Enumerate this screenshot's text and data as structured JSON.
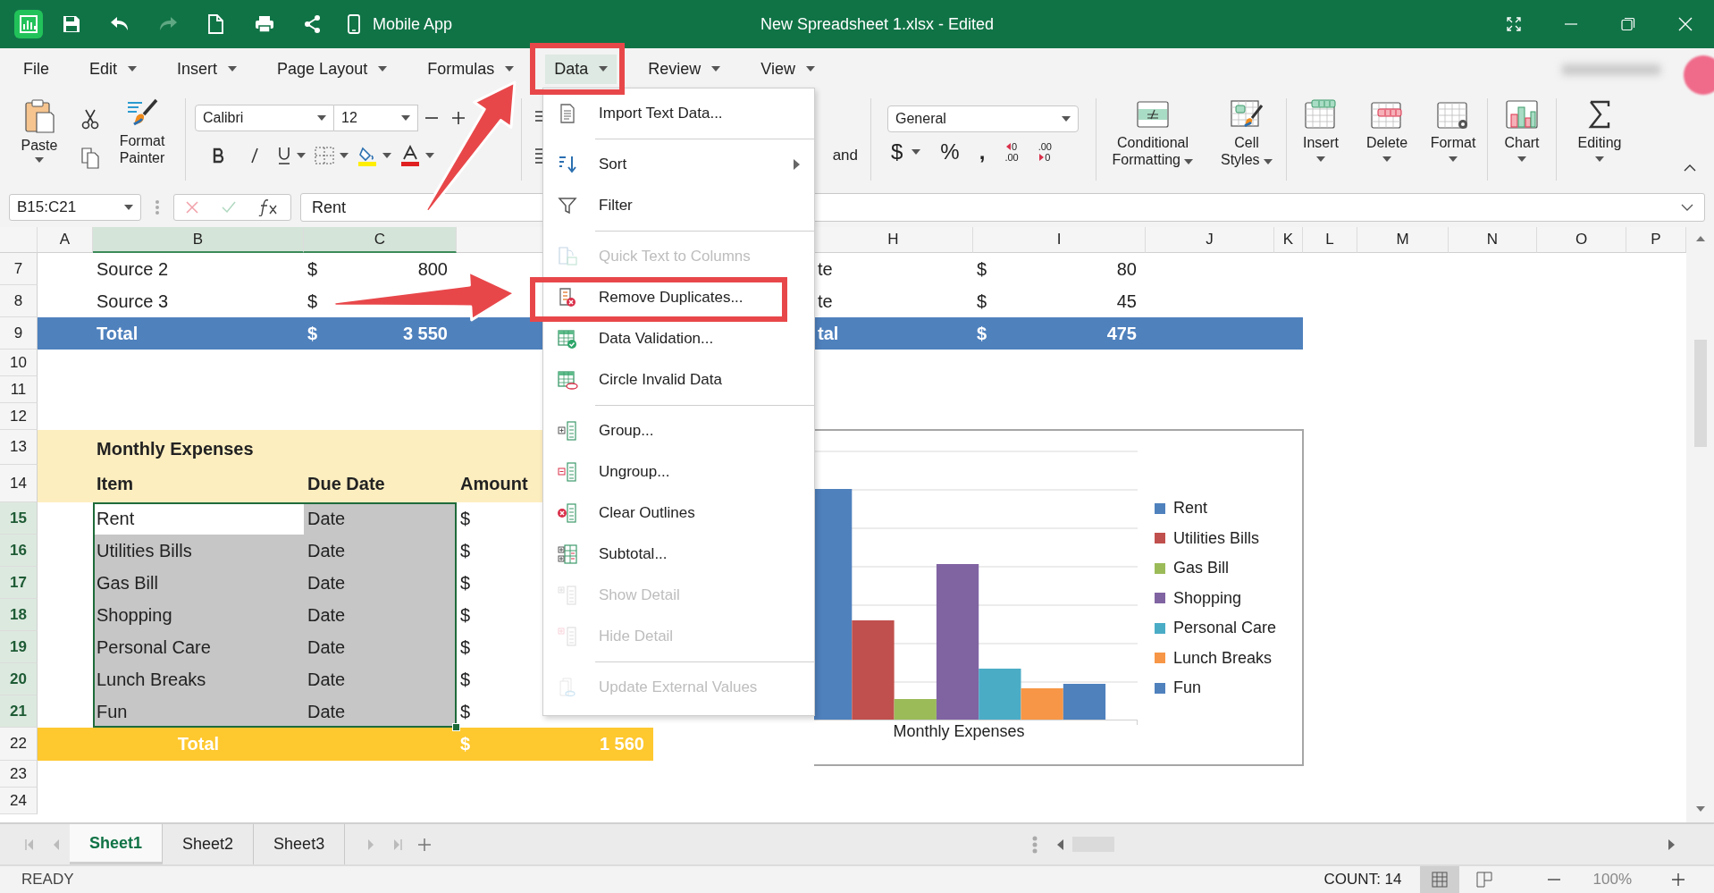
{
  "title_bar": {
    "quick_access": [
      {
        "kind": "save",
        "disabled": false
      },
      {
        "kind": "undo",
        "disabled": false
      },
      {
        "kind": "redo",
        "disabled": true
      },
      {
        "kind": "new",
        "disabled": false
      },
      {
        "kind": "print",
        "disabled": false
      },
      {
        "kind": "share",
        "disabled": false
      }
    ],
    "mobile_app": "Mobile App",
    "title": "New Spreadsheet 1.xlsx - Edited"
  },
  "menu_bar": [
    {
      "label": "File",
      "has_menu": false,
      "selected": false
    },
    {
      "label": "Edit",
      "has_menu": true,
      "selected": false
    },
    {
      "label": "Insert",
      "has_menu": true,
      "selected": false
    },
    {
      "label": "Page Layout",
      "has_menu": true,
      "selected": false
    },
    {
      "label": "Formulas",
      "has_menu": true,
      "selected": false
    },
    {
      "label": "Data",
      "has_menu": true,
      "selected": true
    },
    {
      "label": "Review",
      "has_menu": true,
      "selected": false
    },
    {
      "label": "View",
      "has_menu": true,
      "selected": false
    }
  ],
  "ribbon": {
    "paste": "Paste",
    "format_painter": "Format Painter",
    "font_name": "Calibri",
    "font_size": "12",
    "alignment_fragment": "and",
    "number_format": "General",
    "number_symbols": [
      {
        "kind": "currency",
        "label": "$"
      },
      {
        "kind": "percent",
        "label": "%"
      },
      {
        "kind": "comma",
        "label": ","
      }
    ],
    "decimals": [
      {
        "kind": "increase",
        "upper": "0",
        "lower": ".00"
      },
      {
        "kind": "decrease",
        "upper": ".00",
        "lower": "0"
      }
    ],
    "groups": [
      [
        {
          "kind": "conditional_formatting",
          "label": "Conditional Formatting",
          "has_menu": true
        },
        {
          "kind": "cell_styles",
          "label": "Cell Styles",
          "has_menu": true
        }
      ],
      [
        {
          "kind": "insert",
          "label": "Insert",
          "has_menu": true
        },
        {
          "kind": "delete",
          "label": "Delete",
          "has_menu": true
        },
        {
          "kind": "format",
          "label": "Format",
          "has_menu": true
        }
      ],
      [
        {
          "kind": "chart",
          "label": "Chart",
          "has_menu": true
        }
      ],
      [
        {
          "kind": "editing",
          "label": "Editing",
          "has_menu": true
        }
      ]
    ]
  },
  "formula_bar": {
    "name_box": "B15:C21",
    "value": "Rent"
  },
  "sheet": {
    "columns": [
      {
        "label": "A",
        "selected": false
      },
      {
        "label": "B",
        "selected": true
      },
      {
        "label": "C",
        "selected": true
      },
      {
        "label": "H",
        "selected": false
      },
      {
        "label": "I",
        "selected": false
      },
      {
        "label": "J",
        "selected": false
      },
      {
        "label": "K",
        "selected": false
      },
      {
        "label": "L",
        "selected": false
      },
      {
        "label": "M",
        "selected": false
      },
      {
        "label": "N",
        "selected": false
      },
      {
        "label": "O",
        "selected": false
      },
      {
        "label": "P",
        "selected": false
      }
    ],
    "rows": [
      {
        "number": "7",
        "kind": "plain",
        "selected": false,
        "b": {
          "text": "Source 2"
        },
        "c": {
          "currency": "$",
          "text": "800"
        },
        "h": {
          "text": "te"
        },
        "i": {
          "currency": "$",
          "text": "80"
        }
      },
      {
        "number": "8",
        "kind": "plain",
        "selected": false,
        "b": {
          "text": "Source 3"
        },
        "c": {
          "currency": "$"
        },
        "h": {
          "text": "te"
        },
        "i": {
          "currency": "$",
          "text": "45"
        }
      },
      {
        "number": "9",
        "kind": "blue_total",
        "selected": false,
        "b": {
          "text": "Total"
        },
        "c": {
          "currency": "$",
          "text": "3 550"
        },
        "h": {
          "text": "tal"
        },
        "i": {
          "currency": "$",
          "text": "475"
        }
      },
      {
        "number": "10",
        "kind": "plain",
        "selected": false
      },
      {
        "number": "11",
        "kind": "plain",
        "selected": false
      },
      {
        "number": "12",
        "kind": "plain",
        "selected": false
      },
      {
        "number": "13",
        "kind": "section",
        "selected": false,
        "b": {
          "text": "Monthly Expenses"
        }
      },
      {
        "number": "14",
        "kind": "header",
        "selected": false,
        "b": {
          "text": "Item"
        },
        "c": {
          "text": "Due Date"
        },
        "d": {
          "text": "Amount"
        }
      },
      {
        "number": "15",
        "kind": "plain",
        "selected": true,
        "b": {
          "text": "Rent",
          "active": true
        },
        "c": {
          "text": "Date"
        },
        "d": {
          "currency": "$"
        }
      },
      {
        "number": "16",
        "kind": "plain",
        "selected": true,
        "b": {
          "text": "Utilities Bills",
          "active": false
        },
        "c": {
          "text": "Date"
        },
        "d": {
          "currency": "$"
        }
      },
      {
        "number": "17",
        "kind": "plain",
        "selected": true,
        "b": {
          "text": "Gas Bill",
          "active": false
        },
        "c": {
          "text": "Date"
        },
        "d": {
          "currency": "$"
        }
      },
      {
        "number": "18",
        "kind": "plain",
        "selected": true,
        "b": {
          "text": "Shopping",
          "active": false
        },
        "c": {
          "text": "Date"
        },
        "d": {
          "currency": "$"
        }
      },
      {
        "number": "19",
        "kind": "plain",
        "selected": true,
        "b": {
          "text": "Personal Care",
          "active": false
        },
        "c": {
          "text": "Date"
        },
        "d": {
          "currency": "$"
        }
      },
      {
        "number": "20",
        "kind": "plain",
        "selected": true,
        "b": {
          "text": "Lunch Breaks",
          "active": false
        },
        "c": {
          "text": "Date"
        },
        "d": {
          "currency": "$"
        }
      },
      {
        "number": "21",
        "kind": "plain",
        "selected": true,
        "b": {
          "text": "Fun",
          "active": false
        },
        "c": {
          "text": "Date"
        },
        "d": {
          "currency": "$"
        }
      },
      {
        "number": "22",
        "kind": "gold_total",
        "selected": false,
        "b": {
          "text": "Total"
        },
        "d": {
          "currency": "$",
          "text": "1 560"
        }
      },
      {
        "number": "23",
        "kind": "plain",
        "selected": false
      },
      {
        "number": "24",
        "kind": "plain",
        "selected": false
      }
    ]
  },
  "chart": {
    "category_label": "Monthly Expenses",
    "series": [
      {
        "name": "Rent",
        "color": "#4f81bd"
      },
      {
        "name": "Utilities Bills",
        "color": "#c0504d"
      },
      {
        "name": "Gas Bill",
        "color": "#9bbb59"
      },
      {
        "name": "Shopping",
        "color": "#8064a2"
      },
      {
        "name": "Personal Care",
        "color": "#4bacc6"
      },
      {
        "name": "Lunch Breaks",
        "color": "#f79646"
      },
      {
        "name": "Fun",
        "color": "#4f81bd"
      }
    ]
  },
  "data_menu": [
    {
      "kind": "import",
      "label": "Import Text Data...",
      "disabled": false,
      "submenu": false,
      "separator_after": true
    },
    {
      "kind": "sort",
      "label": "Sort",
      "disabled": false,
      "submenu": true,
      "separator_after": false
    },
    {
      "kind": "filter",
      "label": "Filter",
      "disabled": false,
      "submenu": false,
      "separator_after": true
    },
    {
      "kind": "text_to_columns",
      "label": "Quick Text to Columns",
      "disabled": true,
      "submenu": false,
      "separator_after": false
    },
    {
      "kind": "remove_duplicates",
      "label": "Remove Duplicates...",
      "disabled": false,
      "submenu": false,
      "separator_after": false
    },
    {
      "kind": "validation",
      "label": "Data Validation...",
      "disabled": false,
      "submenu": false,
      "separator_after": false
    },
    {
      "kind": "circle_invalid",
      "label": "Circle Invalid Data",
      "disabled": false,
      "submenu": false,
      "separator_after": true
    },
    {
      "kind": "group",
      "label": "Group...",
      "disabled": false,
      "submenu": false,
      "separator_after": false
    },
    {
      "kind": "ungroup",
      "label": "Ungroup...",
      "disabled": false,
      "submenu": false,
      "separator_after": false
    },
    {
      "kind": "clear_outlines",
      "label": "Clear Outlines",
      "disabled": false,
      "submenu": false,
      "separator_after": false
    },
    {
      "kind": "subtotal",
      "label": "Subtotal...",
      "disabled": false,
      "submenu": false,
      "separator_after": false
    },
    {
      "kind": "show_detail",
      "label": "Show Detail",
      "disabled": true,
      "submenu": false,
      "separator_after": false
    },
    {
      "kind": "hide_detail",
      "label": "Hide Detail",
      "disabled": true,
      "submenu": false,
      "separator_after": true
    },
    {
      "kind": "update_external",
      "label": "Update External Values",
      "disabled": true,
      "submenu": false,
      "separator_after": false
    }
  ],
  "sheet_tabs": [
    {
      "label": "Sheet1",
      "selected": true
    },
    {
      "label": "Sheet2",
      "selected": false
    },
    {
      "label": "Sheet3",
      "selected": false
    }
  ],
  "status_bar": {
    "mode": "READY",
    "count": "COUNT: 14",
    "zoom": "100%",
    "views": [
      {
        "kind": "normal",
        "selected": true
      },
      {
        "kind": "page_layout",
        "selected": false
      }
    ]
  }
}
